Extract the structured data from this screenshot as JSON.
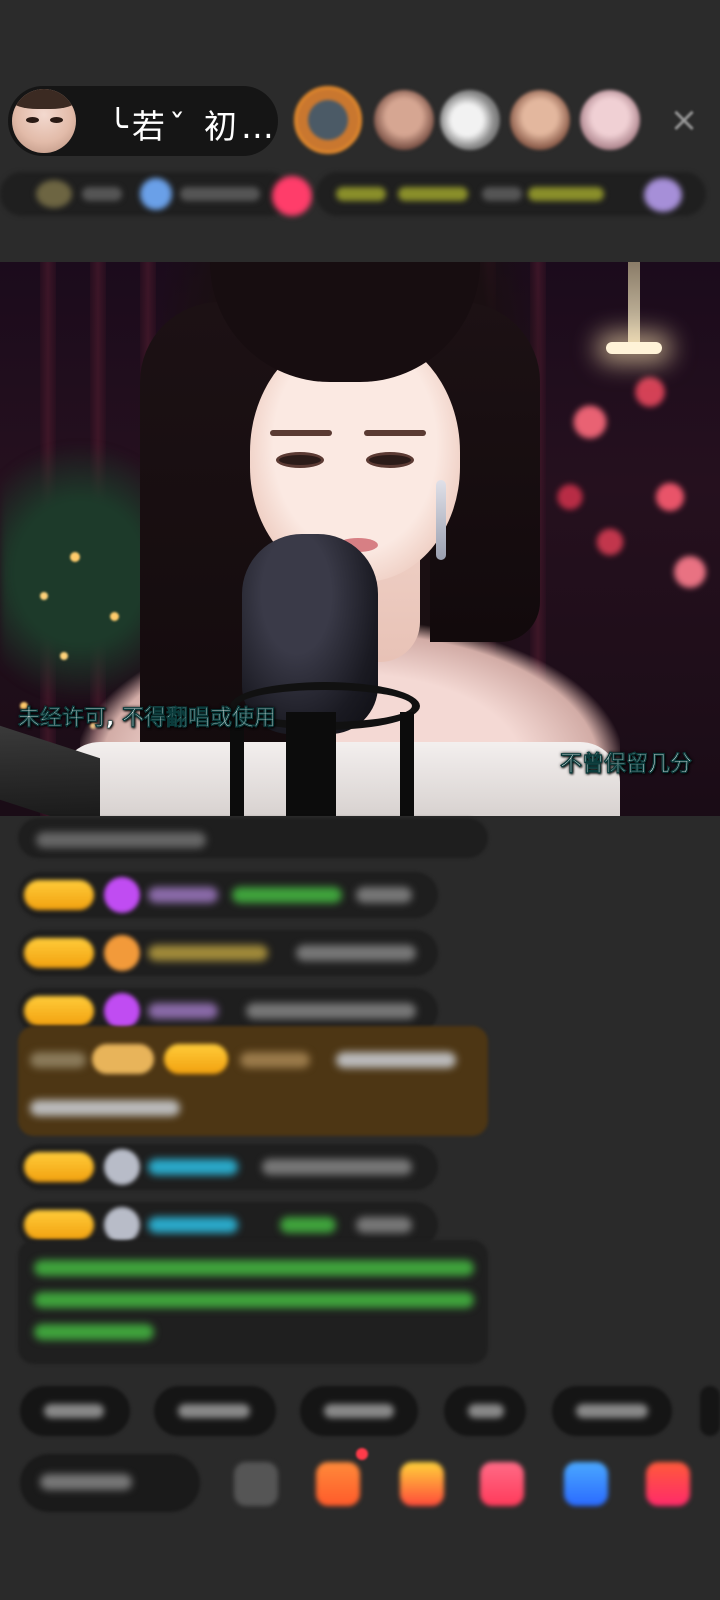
{
  "header": {
    "streamer_name": "╰若ˇ 初…"
  },
  "viewers": [
    {
      "name": "viewer-avatar"
    },
    {
      "name": "viewer-avatar"
    },
    {
      "name": "viewer-avatar"
    },
    {
      "name": "viewer-avatar"
    },
    {
      "name": "viewer-avatar"
    }
  ],
  "video": {
    "subtitle_left": "未经许可, 不得翻唱或使用",
    "subtitle_right": "不曾保留几分"
  },
  "close_icon": "×",
  "colors": {
    "background": "#2a2a2a",
    "badge_gold": "#f2a10f",
    "highlight_brown": "#4d3614",
    "chat_green": "#3fa33c",
    "chat_cyan": "#2aa9c9",
    "chat_purple": "#c04cf2"
  },
  "icons": {
    "close": "close-icon",
    "gift": "gift-icon",
    "emoji": "emoji-icon",
    "share": "share-icon"
  }
}
